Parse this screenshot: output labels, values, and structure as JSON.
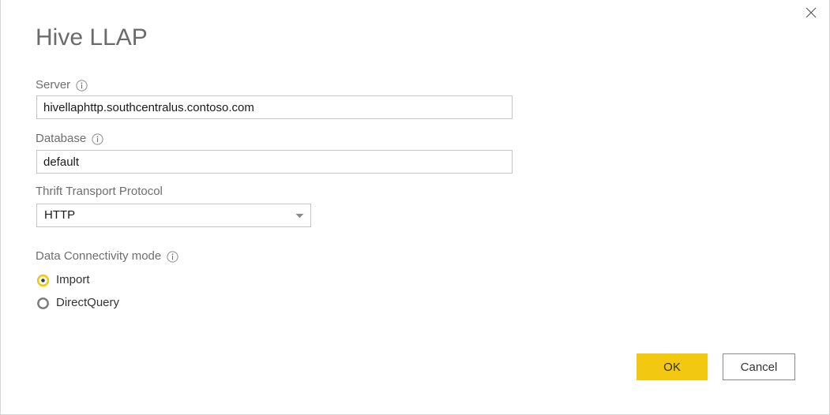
{
  "dialog": {
    "title": "Hive LLAP",
    "close_label": "Close",
    "close_icon": "close-icon"
  },
  "fields": {
    "server": {
      "label": "Server",
      "info_icon": "info-icon",
      "value": "hivellaphttp.southcentralus.contoso.com",
      "placeholder": ""
    },
    "database": {
      "label": "Database",
      "info_icon": "info-icon",
      "value": "default",
      "placeholder": ""
    },
    "thrift_transport_protocol": {
      "label": "Thrift Transport Protocol",
      "value": "HTTP",
      "arrow_icon": "chevron-down-icon",
      "options": [
        "HTTP"
      ]
    },
    "data_connectivity_mode": {
      "label": "Data Connectivity mode",
      "info_icon": "info-icon",
      "selected": "Import",
      "options": [
        {
          "label": "Import",
          "selected": true
        },
        {
          "label": "DirectQuery",
          "selected": false
        }
      ]
    }
  },
  "footer": {
    "ok_label": "OK",
    "cancel_label": "Cancel"
  },
  "colors": {
    "accent": "#f2c811",
    "title_text": "#6b6b6b",
    "label_text": "#6e6e6e",
    "value_text": "#1a1a1a",
    "border": "#c4c4c4",
    "cancel_border": "#8a8a8a",
    "radio_ring_unselected": "#7a7a7a",
    "dialog_border": "#d6d6d6"
  }
}
